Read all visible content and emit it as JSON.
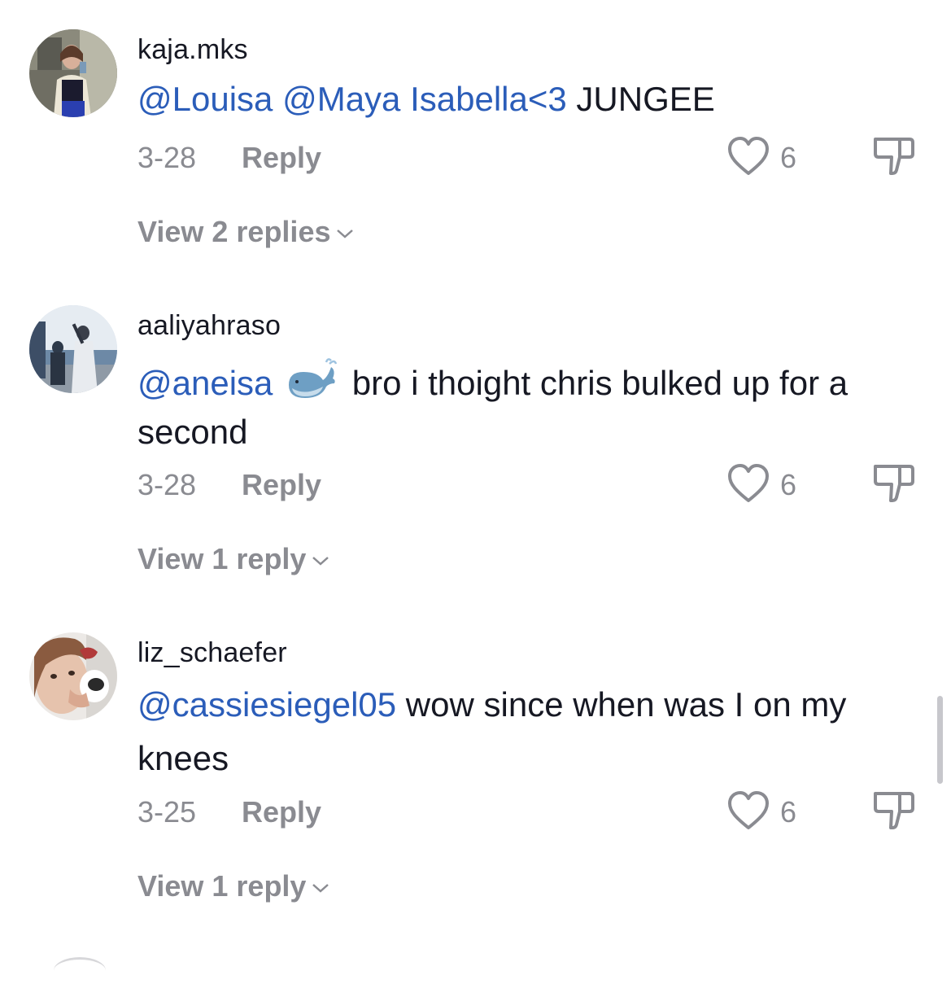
{
  "comments": [
    {
      "username": "kaja.mks",
      "mentions": [
        "@Louisa",
        "@Maya Isabella<3"
      ],
      "text": " JUNGEE",
      "date": "3-28",
      "reply_label": "Reply",
      "likes": "6",
      "view_replies": "View 2 replies"
    },
    {
      "username": "aaliyahraso",
      "mentions": [
        "@aneisa"
      ],
      "text": " bro i thoight chris bulked up for a second",
      "date": "3-28",
      "reply_label": "Reply",
      "likes": "6",
      "view_replies": "View 1 reply"
    },
    {
      "username": "liz_schaefer",
      "mentions": [
        "@cassiesiegel05"
      ],
      "text": " wow since when was I on my knees",
      "date": "3-25",
      "reply_label": "Reply",
      "likes": "6",
      "view_replies": "View 1 reply"
    }
  ],
  "icons": {
    "like": "heart-outline-icon",
    "dislike": "thumbs-down-outline-icon",
    "expand": "chevron-down-icon",
    "emoji": "whale-emoji"
  },
  "colors": {
    "mention": "#2b5db9",
    "text": "#161823",
    "secondary": "#8a8b91"
  }
}
